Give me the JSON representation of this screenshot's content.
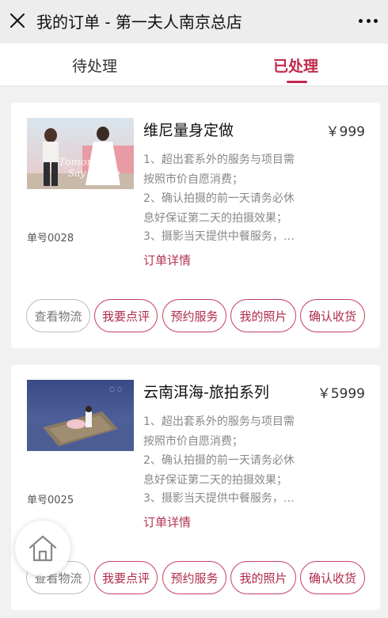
{
  "header": {
    "title": "我的订单 - 第一夫人南京总店",
    "close_icon": "close-icon",
    "more_icon": "more-dots-icon"
  },
  "tabs": [
    {
      "label": "待处理",
      "active": false
    },
    {
      "label": "已处理",
      "active": true
    }
  ],
  "colors": {
    "accent": "#c0294a",
    "text_muted": "#888888",
    "button_grey": "#bdbdbd"
  },
  "orders": [
    {
      "title": "维尼量身定做",
      "price": "￥999",
      "order_no": "单号0028",
      "desc": [
        "1、超出套系外的服务与项目需",
        "按照市价自愿消费；",
        "2、确认拍摄的前一天请务必休",
        "息好保证第二天的拍摄效果；",
        "3、摄影当天提供中餐服务，…"
      ],
      "detail_link": "订单详情",
      "buttons": [
        "查看物流",
        "我要点评",
        "预约服务",
        "我的照片",
        "确认收货"
      ],
      "thumbnail_text": "Tomorrow Say awhile"
    },
    {
      "title": "云南洱海-旅拍系列",
      "price": "￥5999",
      "order_no": "单号0025",
      "desc": [
        "1、超出套系外的服务与项目需",
        "按照市价自愿消费；",
        "2、确认拍摄的前一天请务必休",
        "息好保证第二天的拍摄效果；",
        "3、摄影当天提供中餐服务，…"
      ],
      "detail_link": "订单详情",
      "buttons": [
        "查看物流",
        "我要点评",
        "预约服务",
        "我的照片",
        "确认收货"
      ]
    }
  ],
  "floating": {
    "home_icon": "home-icon"
  }
}
